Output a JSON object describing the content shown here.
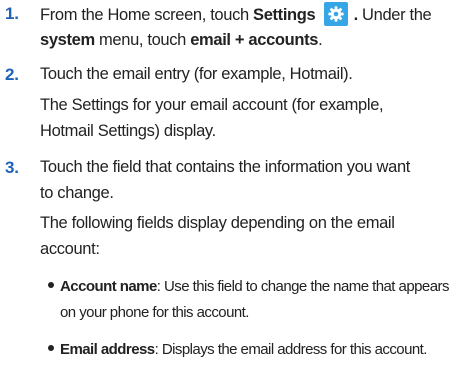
{
  "steps": [
    {
      "number": "1.",
      "line1_prefix": "From the Home screen, touch ",
      "line1_bold": "Settings",
      "line1_suffix": " .",
      "line1_tail": " Under the",
      "line2_bold1": "system",
      "line2_mid": " menu, touch ",
      "line2_bold2": "email + accounts",
      "line2_suffix": ".",
      "icon": "gear-icon",
      "icon_color": "#36a6e6"
    },
    {
      "number": "2.",
      "line1": "Touch the email entry (for example, Hotmail).",
      "line2": "The Settings for your email account (for example,",
      "line3": "Hotmail Settings) display."
    },
    {
      "number": "3.",
      "line1": "Touch the field that contains the information you want",
      "line2": "to change.",
      "line3": "The following fields display depending on the email",
      "line4": "account:"
    }
  ],
  "bullets": [
    {
      "bold": "Account name",
      "text": ": Use this field to change the name that appears",
      "cont": "on your phone for this account."
    },
    {
      "bold": "Email address",
      "text": ": Displays the email address for this account."
    }
  ],
  "colors": {
    "step_number": "#1e62b8",
    "text": "#222222"
  }
}
